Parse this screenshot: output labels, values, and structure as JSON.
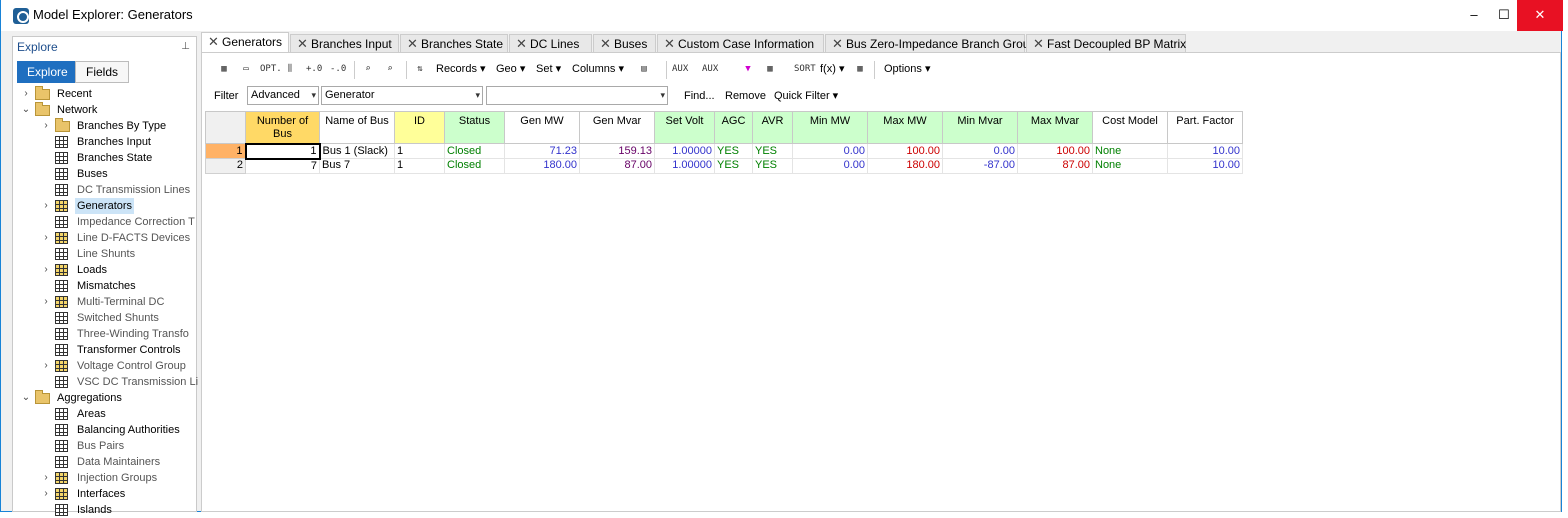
{
  "window": {
    "title": "Model Explorer: Generators",
    "min": "–",
    "max": "☐",
    "close": "✕"
  },
  "explore": {
    "header": "Explore",
    "pin": "⊥",
    "tabs": [
      "Explore",
      "Fields"
    ],
    "tree": [
      {
        "label": "Recent",
        "icon": "folder-icon",
        "chev": ">",
        "level": 0
      },
      {
        "label": "Network",
        "icon": "folder-icon",
        "chev": "v",
        "level": 0
      },
      {
        "label": "Branches By Type",
        "icon": "folder-icon",
        "chev": ">",
        "level": 1
      },
      {
        "label": "Branches Input",
        "icon": "grid-icon",
        "chev": "",
        "level": 1
      },
      {
        "label": "Branches State",
        "icon": "grid-icon",
        "chev": "",
        "level": 1
      },
      {
        "label": "Buses",
        "icon": "grid-icon",
        "chev": "",
        "level": 1
      },
      {
        "label": "DC Transmission Lines",
        "icon": "grid-icon",
        "chev": "",
        "level": 1,
        "dim": true
      },
      {
        "label": "Generators",
        "icon": "grid-icon-yellow",
        "chev": ">",
        "level": 1,
        "selected": true
      },
      {
        "label": "Impedance Correction T",
        "icon": "grid-icon",
        "chev": "",
        "level": 1,
        "dim": true
      },
      {
        "label": "Line D-FACTS Devices",
        "icon": "grid-icon-yellow",
        "chev": ">",
        "level": 1,
        "dim": true
      },
      {
        "label": "Line Shunts",
        "icon": "grid-icon",
        "chev": "",
        "level": 1,
        "dim": true
      },
      {
        "label": "Loads",
        "icon": "grid-icon-yellow",
        "chev": ">",
        "level": 1
      },
      {
        "label": "Mismatches",
        "icon": "grid-icon",
        "chev": "",
        "level": 1
      },
      {
        "label": "Multi-Terminal DC",
        "icon": "grid-icon-yellow",
        "chev": ">",
        "level": 1,
        "dim": true
      },
      {
        "label": "Switched Shunts",
        "icon": "grid-icon",
        "chev": "",
        "level": 1,
        "dim": true
      },
      {
        "label": "Three-Winding Transfo",
        "icon": "grid-icon",
        "chev": "",
        "level": 1,
        "dim": true
      },
      {
        "label": "Transformer Controls",
        "icon": "grid-icon",
        "chev": "",
        "level": 1
      },
      {
        "label": "Voltage Control Group",
        "icon": "grid-icon-yellow",
        "chev": ">",
        "level": 1,
        "dim": true
      },
      {
        "label": "VSC DC Transmission Li",
        "icon": "grid-icon",
        "chev": "",
        "level": 1,
        "dim": true
      },
      {
        "label": "Aggregations",
        "icon": "folder-icon",
        "chev": "v",
        "level": 0
      },
      {
        "label": "Areas",
        "icon": "grid-icon",
        "chev": "",
        "level": 1
      },
      {
        "label": "Balancing Authorities",
        "icon": "grid-icon",
        "chev": "",
        "level": 1
      },
      {
        "label": "Bus Pairs",
        "icon": "grid-icon",
        "chev": "",
        "level": 1,
        "dim": true
      },
      {
        "label": "Data Maintainers",
        "icon": "grid-icon",
        "chev": "",
        "level": 1,
        "dim": true
      },
      {
        "label": "Injection Groups",
        "icon": "grid-icon-yellow",
        "chev": ">",
        "level": 1,
        "dim": true
      },
      {
        "label": "Interfaces",
        "icon": "grid-icon-yellow",
        "chev": ">",
        "level": 1
      },
      {
        "label": "Islands",
        "icon": "grid-icon",
        "chev": "",
        "level": 1
      }
    ]
  },
  "tabs": [
    {
      "label": "Generators",
      "active": true
    },
    {
      "label": "Branches Input"
    },
    {
      "label": "Branches State"
    },
    {
      "label": "DC Lines"
    },
    {
      "label": "Buses"
    },
    {
      "label": "Custom Case Information"
    },
    {
      "label": "Bus Zero-Impedance Branch Group"
    },
    {
      "label": "Fast Decoupled BP Matrix"
    }
  ],
  "toolbar": {
    "records": "Records ▾",
    "geo": "Geo ▾",
    "set": "Set ▾",
    "columns": "Columns ▾",
    "fx": "f(x) ▾",
    "options": "Options ▾",
    "icons": {
      "opt": "OPT.",
      "sort": "SORT",
      "auxa": "AUX"
    }
  },
  "filter": {
    "label": "Filter",
    "mode": "Advanced",
    "object": "Generator",
    "expr": "",
    "find": "Find...",
    "remove": "Remove",
    "quick": "Quick Filter ▾"
  },
  "table": {
    "columns": [
      {
        "label": "Number of Bus",
        "bg": "#ffd966",
        "w": 74
      },
      {
        "label": "Name of Bus",
        "bg": "#ffffff",
        "w": 75
      },
      {
        "label": "ID",
        "bg": "#ffff99",
        "w": 50
      },
      {
        "label": "Status",
        "bg": "#ccffcc",
        "w": 60
      },
      {
        "label": "Gen MW",
        "bg": "#ffffff",
        "w": 75
      },
      {
        "label": "Gen Mvar",
        "bg": "#ffffff",
        "w": 75
      },
      {
        "label": "Set Volt",
        "bg": "#ccffcc",
        "w": 60
      },
      {
        "label": "AGC",
        "bg": "#ccffcc",
        "w": 38
      },
      {
        "label": "AVR",
        "bg": "#ccffcc",
        "w": 40
      },
      {
        "label": "Min MW",
        "bg": "#ccffcc",
        "w": 75
      },
      {
        "label": "Max MW",
        "bg": "#ccffcc",
        "w": 75
      },
      {
        "label": "Min Mvar",
        "bg": "#ccffcc",
        "w": 75
      },
      {
        "label": "Max Mvar",
        "bg": "#ccffcc",
        "w": 75
      },
      {
        "label": "Cost Model",
        "bg": "#ffffff",
        "w": 75
      },
      {
        "label": "Part. Factor",
        "bg": "#ffffff",
        "w": 75
      }
    ],
    "rows": [
      {
        "num": "1",
        "cells": [
          "1",
          "Bus 1 (Slack)",
          "1",
          "Closed",
          "71.23",
          "159.13",
          "1.00000",
          "YES",
          "YES",
          "0.00",
          "100.00",
          "0.00",
          "100.00",
          "None",
          "10.00"
        ]
      },
      {
        "num": "2",
        "cells": [
          "7",
          "Bus 7",
          "1",
          "Closed",
          "180.00",
          "87.00",
          "1.00000",
          "YES",
          "YES",
          "0.00",
          "180.00",
          "-87.00",
          "87.00",
          "None",
          "10.00"
        ]
      }
    ],
    "cell_colors": [
      "#000000",
      "#000000",
      "#000000",
      "#008000",
      "#3333cc",
      "#660066",
      "#3333cc",
      "#008000",
      "#008000",
      "#3333cc",
      "#cc0000",
      "#3333cc",
      "#cc0000",
      "#008000",
      "#3333cc"
    ],
    "cell_align": [
      "right",
      "left",
      "left",
      "left",
      "right",
      "right",
      "right",
      "left",
      "left",
      "right",
      "right",
      "right",
      "right",
      "left",
      "right"
    ]
  }
}
